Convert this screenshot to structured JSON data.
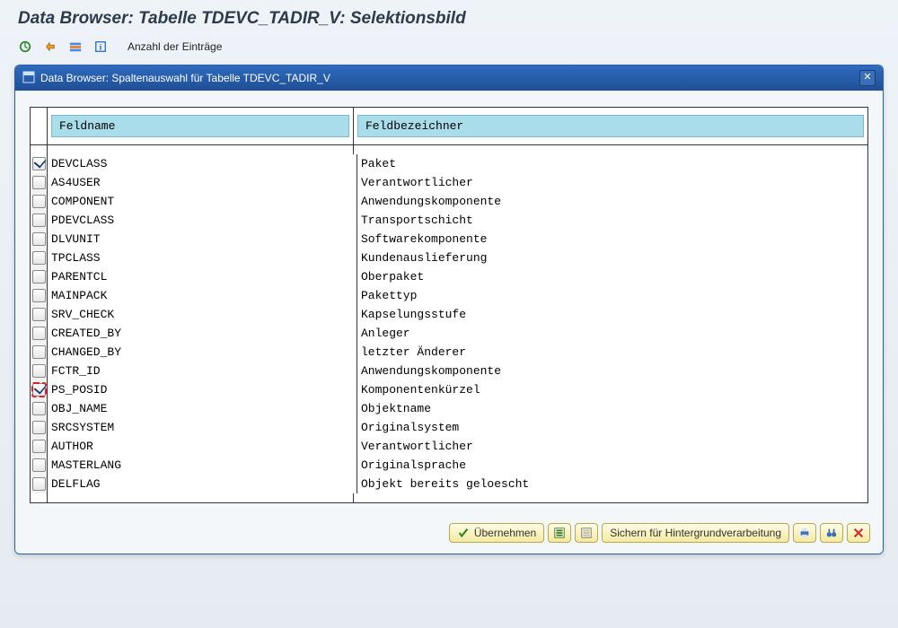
{
  "page_title": "Data Browser: Tabelle TDEVC_TADIR_V: Selektionsbild",
  "toolbar": {
    "entries_label": "Anzahl der Einträge"
  },
  "dialog": {
    "title": "Data Browser: Spaltenauswahl für Tabelle  TDEVC_TADIR_V",
    "col_name_header": "Feldname",
    "col_desc_header": "Feldbezeichner",
    "rows": [
      {
        "field": "DEVCLASS",
        "label": "Paket",
        "checked": true,
        "highlight": false
      },
      {
        "field": "AS4USER",
        "label": "Verantwortlicher",
        "checked": false,
        "highlight": false
      },
      {
        "field": "COMPONENT",
        "label": "Anwendungskomponente",
        "checked": false,
        "highlight": false
      },
      {
        "field": "PDEVCLASS",
        "label": "Transportschicht",
        "checked": false,
        "highlight": false
      },
      {
        "field": "DLVUNIT",
        "label": "Softwarekomponente",
        "checked": false,
        "highlight": false
      },
      {
        "field": "TPCLASS",
        "label": "Kundenauslieferung",
        "checked": false,
        "highlight": false
      },
      {
        "field": "PARENTCL",
        "label": "Oberpaket",
        "checked": false,
        "highlight": false
      },
      {
        "field": "MAINPACK",
        "label": "Pakettyp",
        "checked": false,
        "highlight": false
      },
      {
        "field": "SRV_CHECK",
        "label": "Kapselungsstufe",
        "checked": false,
        "highlight": false
      },
      {
        "field": "CREATED_BY",
        "label": "Anleger",
        "checked": false,
        "highlight": false
      },
      {
        "field": "CHANGED_BY",
        "label": "letzter Änderer",
        "checked": false,
        "highlight": false
      },
      {
        "field": "FCTR_ID",
        "label": "Anwendungskomponente",
        "checked": false,
        "highlight": false
      },
      {
        "field": "PS_POSID",
        "label": "Komponentenkürzel",
        "checked": true,
        "highlight": true
      },
      {
        "field": "OBJ_NAME",
        "label": "Objektname",
        "checked": false,
        "highlight": false
      },
      {
        "field": "SRCSYSTEM",
        "label": "Originalsystem",
        "checked": false,
        "highlight": false
      },
      {
        "field": "AUTHOR",
        "label": "Verantwortlicher",
        "checked": false,
        "highlight": false
      },
      {
        "field": "MASTERLANG",
        "label": "Originalsprache",
        "checked": false,
        "highlight": false
      },
      {
        "field": "DELFLAG",
        "label": "Objekt  bereits geloescht",
        "checked": false,
        "highlight": false
      }
    ]
  },
  "buttons": {
    "apply": "Übernehmen",
    "save_bg": "Sichern für Hintergrundverarbeitung"
  }
}
